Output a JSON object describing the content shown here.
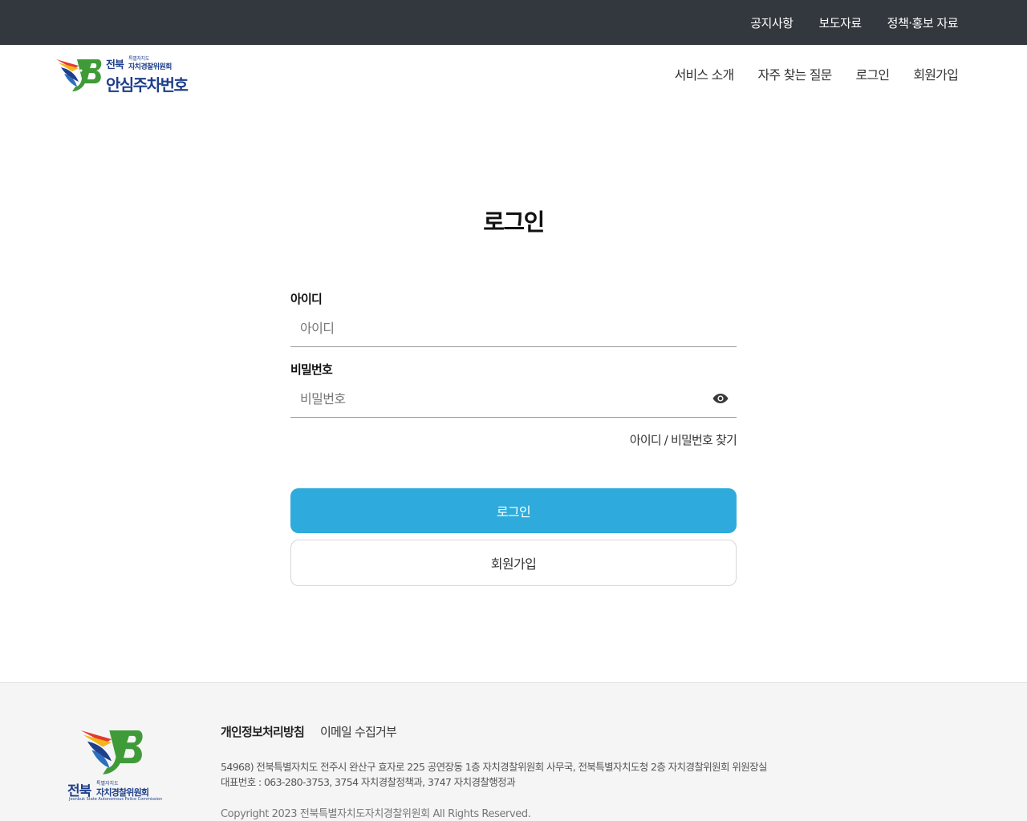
{
  "topbar": {
    "links": [
      "공지사항",
      "보도자료",
      "정책·홍보 자료"
    ]
  },
  "header": {
    "logo": {
      "region": "전북",
      "org_small": "특별자치도",
      "org": "자치경찰위원회",
      "service": "안심주차번호"
    },
    "nav": [
      "서비스 소개",
      "자주 찾는 질문",
      "로그인",
      "회원가입"
    ]
  },
  "login": {
    "title": "로그인",
    "id_label": "아이디",
    "id_placeholder": "아이디",
    "pw_label": "비밀번호",
    "pw_placeholder": "비밀번호",
    "find_link": "아이디 / 비밀번호 찾기",
    "login_button": "로그인",
    "join_button": "회원가입"
  },
  "footer": {
    "logo": {
      "region": "전북",
      "org_small": "특별자치도",
      "org": "자치경찰위원회",
      "english": "Jeonbuk State Autonomous Police Commission"
    },
    "links": {
      "privacy": "개인정보처리방침",
      "email_refusal": "이메일 수집거부"
    },
    "address": "54968) 전북특별자치도 전주시 완산구 효자로 225 공연장동 1층 자치경찰위원회 사무국, 전북특별자치도청 2층 자치경찰위원회 위원장실",
    "phone": "대표번호 : 063-280-3753, 3754 자치경찰정책과, 3747 자치경찰행정과",
    "copyright": "Copyright 2023 전북특별자치도자치경찰위원회 All Rights Reserved."
  },
  "colors": {
    "topbar_bg": "#33383e",
    "primary": "#2eabdc",
    "logo_blue": "#1e3f8a",
    "logo_green": "#3f9b38",
    "footer_bg": "#f5f5f5"
  },
  "icons": {
    "password_toggle": "eye-icon",
    "logo_mark": "bird-emblem-icon"
  }
}
